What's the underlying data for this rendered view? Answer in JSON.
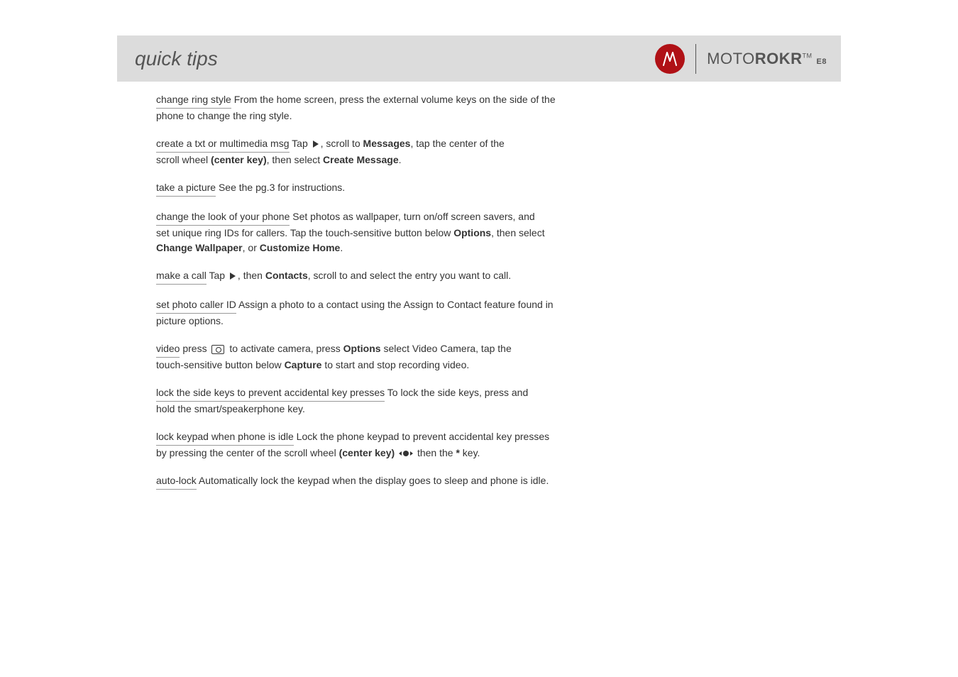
{
  "header": {
    "title": "quick tips",
    "productFirst": "MOTO",
    "productBold": "ROKR",
    "productTM": "TM",
    "productSuffix": "E8"
  },
  "sections": {
    "s1": {
      "label": "change ring style",
      "text1": " From the home screen, press the external volume keys on the side of the",
      "text2": "phone to change the ring style."
    },
    "s2": {
      "label": "create a txt or multimedia msg",
      "text1": " Tap ",
      "text2": ", scroll to ",
      "bold1": "Messages",
      "text3": ", tap the center of the",
      "text4": "scroll wheel ",
      "bold2": "(center key)",
      "text5": ", then select ",
      "bold3": "Create Message",
      "text6": "."
    },
    "s3": {
      "label": "take a picture",
      "text1": " See the pg.3 for instructions."
    },
    "s4": {
      "label": "change the look of your phone",
      "text1": " Set photos as wallpaper, turn on/off screen savers, and",
      "text2": "set unique ring IDs for callers. Tap the touch-sensitive button below ",
      "bold1": "Options",
      "text3": ", then select",
      "bold2": "Change Wallpaper",
      "text4": ", or ",
      "bold3": "Customize Home",
      "text5": "."
    },
    "s5": {
      "label": "make a call",
      "text1": " Tap ",
      "text2": ", then ",
      "bold1": "Contacts",
      "text3": ", scroll to and select the entry you want to call."
    },
    "s6": {
      "label": "set photo caller ID",
      "text1": " Assign a photo to a contact using the Assign to Contact feature found in",
      "text2": "picture options."
    },
    "s7": {
      "label": "video",
      "text1": " press ",
      "text2": " to activate camera, press ",
      "bold1": "Options",
      "text3": " select Video Camera, tap the",
      "text4": "touch-sensitive button below ",
      "bold2": "Capture",
      "text5": " to start and stop recording video."
    },
    "s8": {
      "label": "lock the side keys to prevent accidental key presses",
      "text1": " To lock the side keys, press and",
      "text2": "hold the smart/speakerphone key."
    },
    "s9": {
      "label": "lock keypad when phone is idle",
      "text1": " Lock the phone keypad to prevent accidental key presses",
      "text2": "by pressing the center of the scroll wheel ",
      "bold1": "(center key)",
      "text3": " ",
      "text4": " then the ",
      "bold2": "*",
      "text5": " key."
    },
    "s10": {
      "label": "auto-lock",
      "text1": " Automatically lock the keypad when the display goes to sleep and phone is idle."
    }
  }
}
